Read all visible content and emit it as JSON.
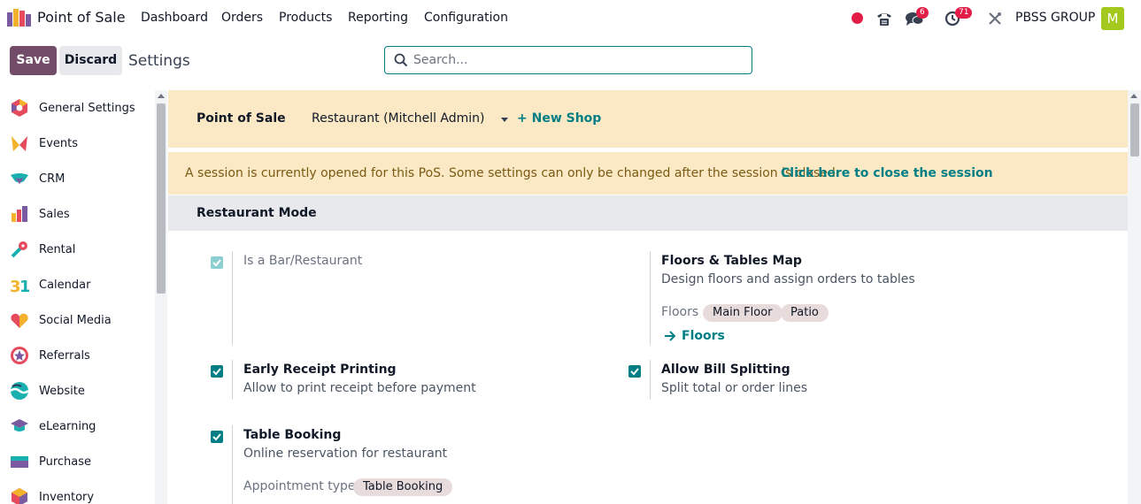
{
  "navbar": {
    "app_name": "Point of Sale",
    "menus": [
      "Dashboard",
      "Orders",
      "Products",
      "Reporting",
      "Configuration"
    ],
    "messages_count": "6",
    "activities_count": "71",
    "company": "PBSS GROUP",
    "avatar_letter": "M"
  },
  "control_panel": {
    "save_label": "Save",
    "discard_label": "Discard",
    "breadcrumb": "Settings",
    "search_placeholder": "Search..."
  },
  "sidebar": {
    "items": [
      {
        "label": "General Settings",
        "icon": "general-settings-icon"
      },
      {
        "label": "Events",
        "icon": "events-icon"
      },
      {
        "label": "CRM",
        "icon": "crm-icon"
      },
      {
        "label": "Sales",
        "icon": "sales-icon"
      },
      {
        "label": "Rental",
        "icon": "rental-icon"
      },
      {
        "label": "Calendar",
        "icon": "calendar-icon"
      },
      {
        "label": "Social Media",
        "icon": "social-media-icon"
      },
      {
        "label": "Referrals",
        "icon": "referrals-icon"
      },
      {
        "label": "Website",
        "icon": "website-icon"
      },
      {
        "label": "eLearning",
        "icon": "elearning-icon"
      },
      {
        "label": "Purchase",
        "icon": "purchase-icon"
      },
      {
        "label": "Inventory",
        "icon": "inventory-icon"
      }
    ]
  },
  "shop_bar": {
    "label": "Point of Sale",
    "selected_shop": "Restaurant (Mitchell Admin)",
    "new_shop": "+ New Shop"
  },
  "alert": {
    "text": "A session is currently opened for this PoS. Some settings can only be changed after the session is closed.",
    "link": "Click here to close the session"
  },
  "section": {
    "title": "Restaurant Mode"
  },
  "settings": {
    "bar_restaurant": {
      "title": "Is a Bar/Restaurant",
      "checked": true
    },
    "floors": {
      "title": "Floors & Tables Map",
      "desc": "Design floors and assign orders to tables",
      "field_label": "Floors",
      "tags": [
        "Main Floor",
        "Patio"
      ],
      "link": "Floors"
    },
    "early_receipt": {
      "title": "Early Receipt Printing",
      "desc": "Allow to print receipt before payment",
      "checked": true
    },
    "bill_splitting": {
      "title": "Allow Bill Splitting",
      "desc": "Split total or order lines",
      "checked": true
    },
    "table_booking": {
      "title": "Table Booking",
      "desc": "Online reservation for restaurant",
      "checked": true,
      "field_label": "Appointment type",
      "tag": "Table Booking"
    }
  },
  "colors": {
    "brand": "#714b67",
    "accent": "#017e84",
    "warning_bg": "#fbe9c5"
  }
}
